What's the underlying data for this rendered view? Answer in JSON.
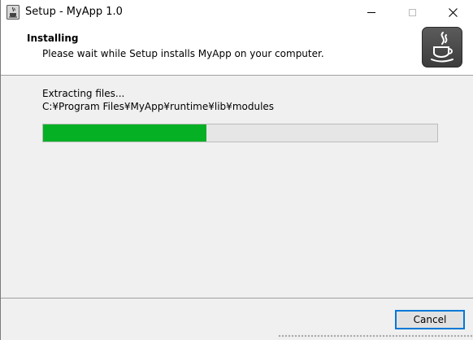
{
  "window": {
    "title": "Setup - MyApp 1.0",
    "app_icon": "installer-icon"
  },
  "caption_buttons": {
    "minimize": "minimize-icon",
    "maximize": "maximize-icon",
    "close": "close-icon",
    "close_glyph": "✕"
  },
  "header": {
    "title": "Installing",
    "subtitle": "Please wait while Setup installs MyApp on your computer.",
    "logo": "java-logo-icon"
  },
  "progress": {
    "status_label": "Extracting files...",
    "current_file": "C:¥Program Files¥MyApp¥runtime¥lib¥modules",
    "fraction": 0.415,
    "color": "#06b025"
  },
  "footer": {
    "cancel_label": "Cancel",
    "accent": "#0078d7"
  }
}
